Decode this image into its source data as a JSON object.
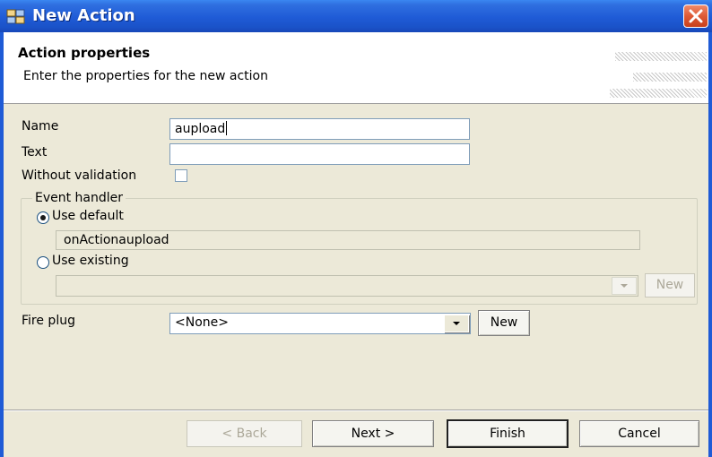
{
  "window": {
    "title": "New Action",
    "icon": "application-icon",
    "close_icon": "close-icon"
  },
  "header": {
    "title": "Action properties",
    "description": "Enter the properties for the new action"
  },
  "form": {
    "name_label": "Name",
    "name_value": "aupload",
    "text_label": "Text",
    "text_value": "",
    "without_validation_label": "Without validation",
    "without_validation_checked": false
  },
  "event_handler": {
    "group_title": "Event handler",
    "use_default_label": "Use default",
    "use_default_selected": true,
    "default_value": "onActionaupload",
    "use_existing_label": "Use existing",
    "use_existing_selected": false,
    "existing_value": "",
    "new_button_label": "New"
  },
  "fire_plug": {
    "label": "Fire plug",
    "selected": "<None>",
    "new_button_label": "New"
  },
  "buttons": {
    "back": "< Back",
    "next": "Next >",
    "finish": "Finish",
    "cancel": "Cancel"
  },
  "colors": {
    "titlebar": "#1f5bd6",
    "close_button": "#de5a36",
    "dialog_background": "#ece9d8",
    "field_border": "#7f9db9"
  }
}
